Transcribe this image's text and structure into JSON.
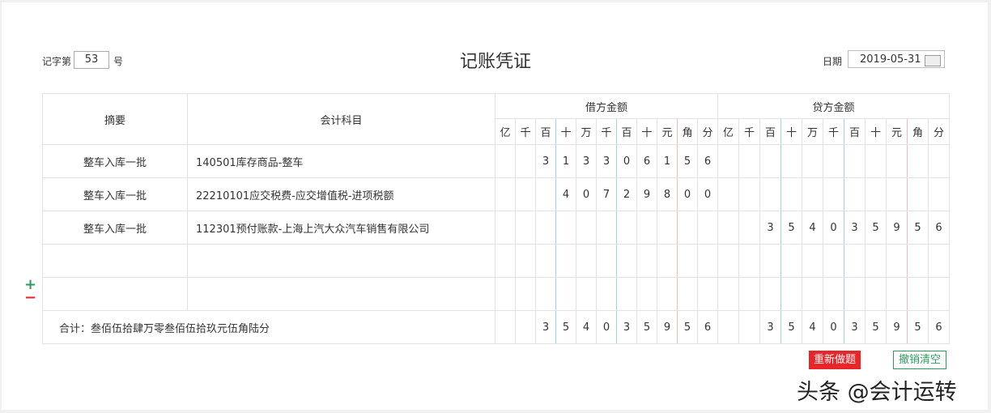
{
  "header": {
    "voucher_prefix": "记字第",
    "voucher_no": "53",
    "voucher_suffix": "号",
    "title": "记账凭证",
    "date_label": "日期",
    "date": "2019-05-31"
  },
  "table": {
    "col_summary": "摘要",
    "col_account": "会计科目",
    "col_debit": "借方金额",
    "col_credit": "贷方金额",
    "units": [
      "亿",
      "千",
      "百",
      "十",
      "万",
      "千",
      "百",
      "十",
      "元",
      "角",
      "分"
    ],
    "rows": [
      {
        "summary": "整车入库一批",
        "account": "140501库存商品-整车",
        "debit": [
          "",
          "",
          "3",
          "1",
          "3",
          "3",
          "0",
          "6",
          "1",
          "5",
          "6"
        ],
        "credit": [
          "",
          "",
          "",
          "",
          "",
          "",
          "",
          "",
          "",
          "",
          ""
        ]
      },
      {
        "summary": "整车入库一批",
        "account": "22210101应交税费-应交增值税-进项税额",
        "debit": [
          "",
          "",
          "",
          "4",
          "0",
          "7",
          "2",
          "9",
          "8",
          "0",
          "0"
        ],
        "credit": [
          "",
          "",
          "",
          "",
          "",
          "",
          "",
          "",
          "",
          "",
          ""
        ]
      },
      {
        "summary": "整车入库一批",
        "account": "112301预付账款-上海上汽大众汽车销售有限公司",
        "debit": [
          "",
          "",
          "",
          "",
          "",
          "",
          "",
          "",
          "",
          "",
          ""
        ],
        "credit": [
          "",
          "",
          "3",
          "5",
          "4",
          "0",
          "3",
          "5",
          "9",
          "5",
          "6"
        ]
      },
      {
        "summary": "",
        "account": "",
        "debit": [
          "",
          "",
          "",
          "",
          "",
          "",
          "",
          "",
          "",
          "",
          ""
        ],
        "credit": [
          "",
          "",
          "",
          "",
          "",
          "",
          "",
          "",
          "",
          "",
          ""
        ]
      },
      {
        "summary": "",
        "account": "",
        "debit": [
          "",
          "",
          "",
          "",
          "",
          "",
          "",
          "",
          "",
          "",
          ""
        ],
        "credit": [
          "",
          "",
          "",
          "",
          "",
          "",
          "",
          "",
          "",
          "",
          ""
        ]
      }
    ],
    "total": {
      "label": "合计：叁佰伍拾肆万零叁佰伍拾玖元伍角陆分",
      "debit": [
        "",
        "",
        "3",
        "5",
        "4",
        "0",
        "3",
        "5",
        "9",
        "5",
        "6"
      ],
      "credit": [
        "",
        "",
        "3",
        "5",
        "4",
        "0",
        "3",
        "5",
        "9",
        "5",
        "6"
      ]
    }
  },
  "actions": {
    "add": "+",
    "remove": "−",
    "redo": "重新做题",
    "clear": "撤销清空"
  },
  "watermark": "头条 @会计运转"
}
